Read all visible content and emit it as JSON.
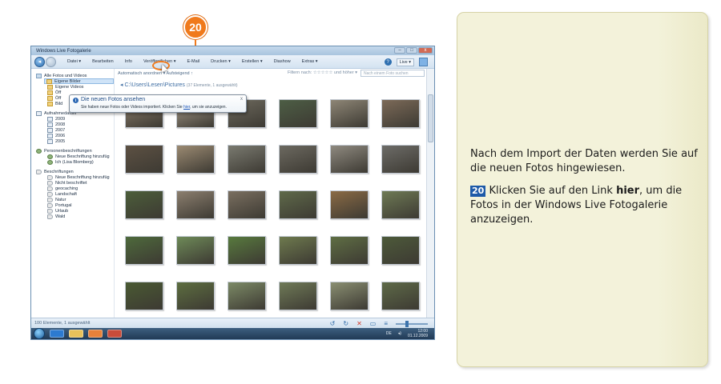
{
  "step": {
    "number": "20"
  },
  "window": {
    "title": "Windows Live Fotogalerie",
    "controls": [
      "–",
      "□",
      "x"
    ]
  },
  "menu": {
    "items": [
      "Datei ▾",
      "Bearbeiten",
      "Info",
      "Veröffentlichen ▾",
      "E-Mail",
      "Drucken ▾",
      "Erstellen ▾",
      "Diashow",
      "Extras ▾"
    ],
    "live": "Live ▾"
  },
  "sidebar": {
    "all": "Alle Fotos und Videos",
    "library": [
      "Eigene Bilder",
      "Eigene Videos",
      "Öff",
      "Öff",
      "Bild"
    ],
    "date_head": "Aufnahmedatum",
    "years": [
      "2009",
      "2008",
      "2007",
      "2006",
      "2005"
    ],
    "people_head": "Personenbeschriftungen",
    "people": [
      "Neue Beschriftung hinzufüg",
      "Ich (Lisa Blomberg)"
    ],
    "tags_head": "Beschriftungen",
    "tags": [
      "Neue Beschriftung hinzufüg",
      "Nicht beschriftet",
      "geocaching",
      "Landschaft",
      "Natur",
      "Portugal",
      "Urlaub",
      "Wald"
    ]
  },
  "toolbar": {
    "arrange": "Automatisch anordnen ▾  Aufsteigend ↑",
    "filter": "Filtern nach: ☆☆☆☆☆ und höher ▾",
    "search_placeholder": "Nach einem Foto suchen"
  },
  "path": {
    "text": "◂ C:\\Users\\Lesen\\Pictures",
    "count": "(37 Elemente, 1 ausgewählt)"
  },
  "popup": {
    "icon": "i",
    "title": "Die neuen Fotos ansehen",
    "text_before": "Sie haben neue Fotos oder Videos importiert. Klicken Sie ",
    "link": "hier",
    "text_after": ", um sie anzuzeigen.",
    "close": "x"
  },
  "status": {
    "text": "100 Elemente, 1 ausgewählt"
  },
  "taskbar": {
    "lang": "DE",
    "time": "12:00",
    "date": "01.12.2009"
  },
  "thumbs": {
    "colors": [
      [
        "#8a7d6b",
        "#a79b8a",
        "#6e6a5e",
        "#4d5e45",
        "#8e8676",
        "#7c6a58"
      ],
      [
        "#5d5143",
        "#9b8a72",
        "#7a7a70",
        "#6c6960",
        "#8f8a80",
        "#6d6c68"
      ],
      [
        "#4c5e3a",
        "#8c7f6f",
        "#7a6f60",
        "#5f6a4a",
        "#8b6b45",
        "#6e7a55"
      ],
      [
        "#4e6a3c",
        "#6e8a58",
        "#587a3e",
        "#6e7a4e",
        "#5f6e44",
        "#4d5a3a"
      ],
      [
        "#4a5a33",
        "#5d6e40",
        "#7c8a66",
        "#6f7a57",
        "#8a8f72",
        "#5e6a48"
      ]
    ]
  },
  "panel": {
    "intro": "Nach dem Import der Daten werden Sie auf die neuen Fotos hingewiesen.",
    "step_number": "20",
    "instruction_before": " Klicken Sie auf den Link ",
    "instruction_bold": "hier",
    "instruction_after": ", um die Fotos  in der Windows Live Fotogalerie anzuzeigen."
  }
}
